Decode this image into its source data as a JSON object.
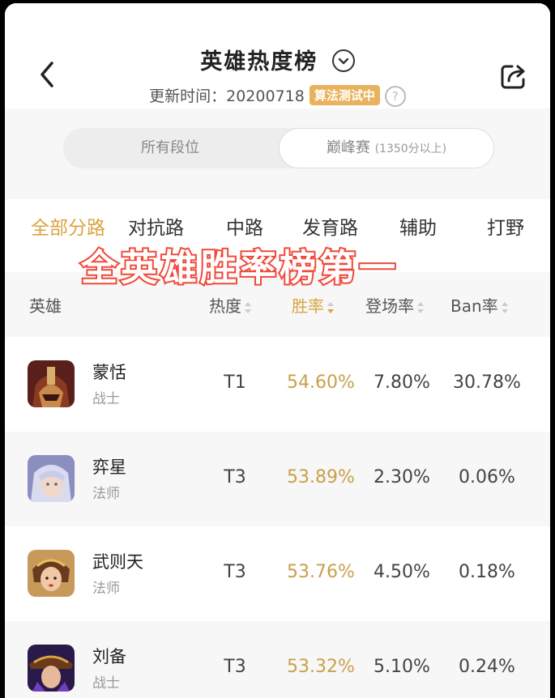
{
  "header": {
    "title": "英雄热度榜",
    "update_label": "更新时间：20200718",
    "badge": "算法测试中",
    "help": "?"
  },
  "segments": {
    "all_ranks": "所有段位",
    "peak_label": "巅峰赛",
    "peak_note": "(1350分以上)"
  },
  "tabs": [
    "全部分路",
    "对抗路",
    "中路",
    "发育路",
    "辅助",
    "打野"
  ],
  "overlay_text": "全英雄胜率榜第一",
  "columns": {
    "hero": "英雄",
    "heat": "热度",
    "win": "胜率",
    "pick": "登场率",
    "ban": "Ban率"
  },
  "heroes": [
    {
      "name": "蒙恬",
      "role": "战士",
      "tier": "T1",
      "win": "54.60%",
      "pick": "7.80%",
      "ban": "30.78%"
    },
    {
      "name": "弈星",
      "role": "法师",
      "tier": "T3",
      "win": "53.89%",
      "pick": "2.30%",
      "ban": "0.06%"
    },
    {
      "name": "武则天",
      "role": "法师",
      "tier": "T3",
      "win": "53.76%",
      "pick": "4.50%",
      "ban": "0.18%"
    },
    {
      "name": "刘备",
      "role": "战士",
      "tier": "T3",
      "win": "53.32%",
      "pick": "5.10%",
      "ban": "0.24%"
    }
  ],
  "colors": {
    "accent": "#d9a441",
    "overlay_stroke": "#f04a3c",
    "badge": "#e9b25c"
  },
  "icons": {
    "back": "chevron-left-icon",
    "dropdown": "chevron-down-circle-icon",
    "share": "share-icon",
    "help": "question-circle-icon"
  }
}
